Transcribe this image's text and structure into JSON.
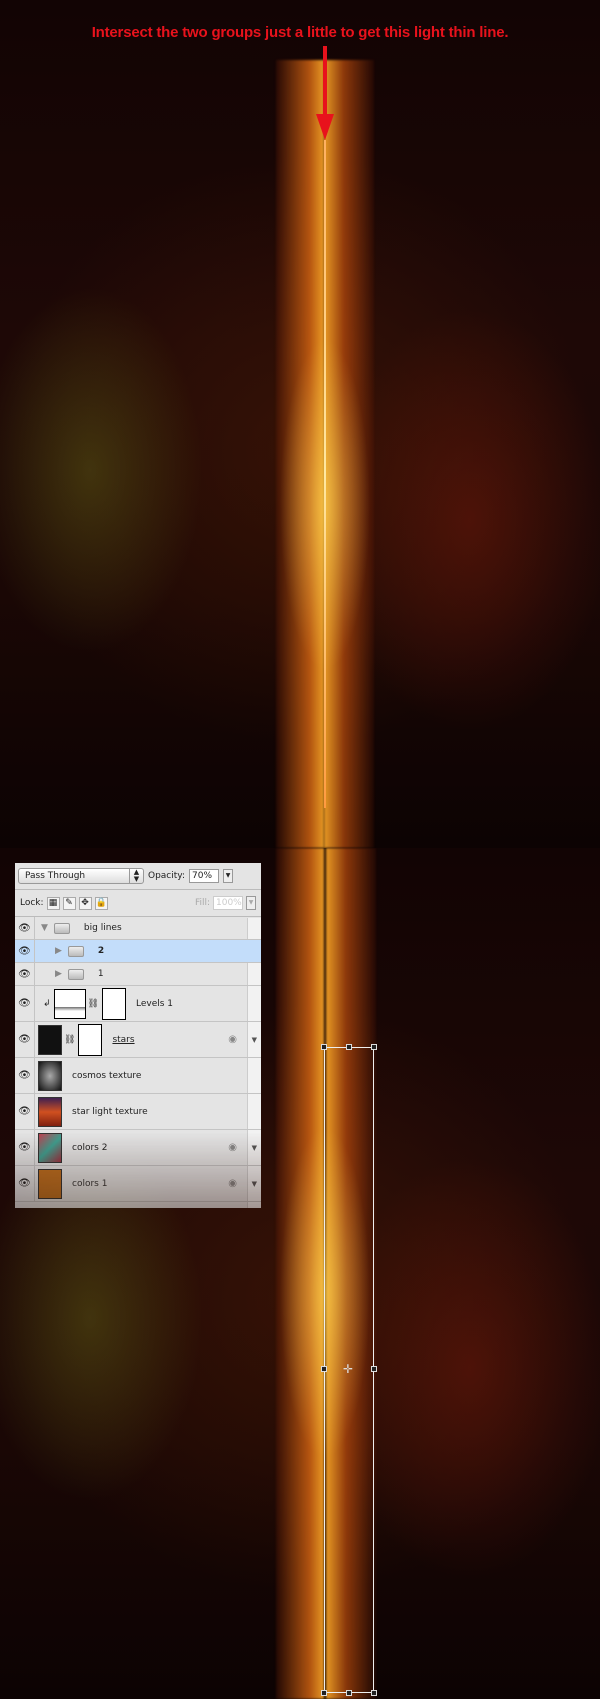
{
  "annotation": {
    "caption": "Intersect the two groups just a little to get this light thin line.",
    "color": "#e8121c"
  },
  "layers_panel": {
    "blend_mode": "Pass Through",
    "opacity_label": "Opacity:",
    "opacity_value": "70%",
    "lock_label": "Lock:",
    "fill_label": "Fill:",
    "fill_value": "100%",
    "layers": [
      {
        "name": "big lines",
        "type": "group",
        "expanded": true
      },
      {
        "name": "2",
        "type": "group",
        "selected": true
      },
      {
        "name": "1",
        "type": "group"
      },
      {
        "name": "Levels 1",
        "type": "adjustment"
      },
      {
        "name": "stars",
        "type": "smart-object",
        "has_fx": true
      },
      {
        "name": "cosmos texture",
        "type": "smart-object"
      },
      {
        "name": "star light texture",
        "type": "smart-object"
      },
      {
        "name": "colors 2",
        "type": "smart-object",
        "has_fx": true
      },
      {
        "name": "colors 1",
        "type": "smart-object",
        "has_fx": true
      }
    ],
    "selected_color": "#c3ddfa"
  }
}
